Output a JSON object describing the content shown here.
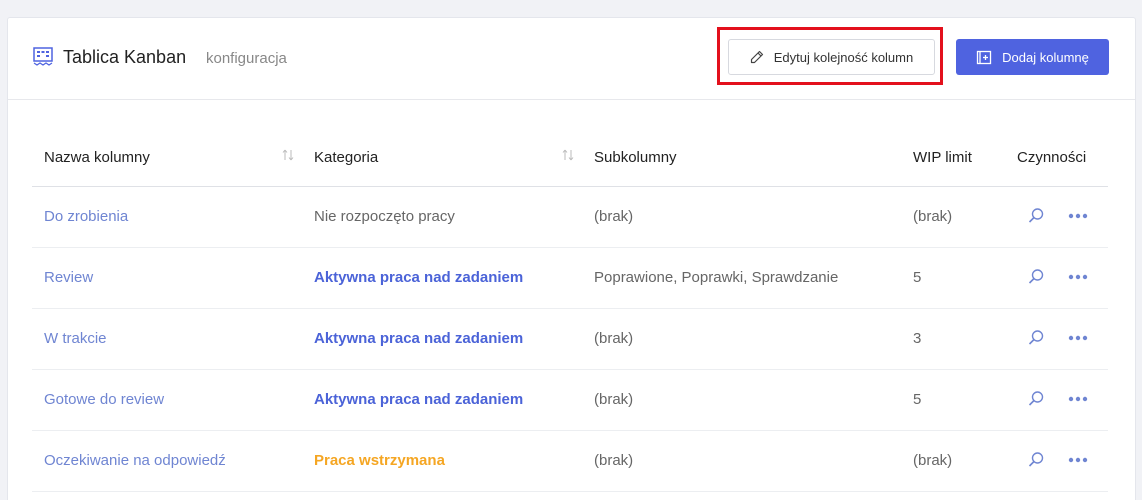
{
  "header": {
    "title": "Tablica Kanban",
    "subtitle": "konfiguracja",
    "edit_order_label": "Edytuj kolejność kolumn",
    "add_column_label": "Dodaj kolumnę"
  },
  "colors": {
    "accent": "#4f63e0",
    "link": "#6f85d2",
    "active_work": "#4b63d8",
    "paused": "#f5a623",
    "highlight": "#e3101c"
  },
  "table": {
    "headers": {
      "name": "Nazwa kolumny",
      "category": "Kategoria",
      "subcolumns": "Subkolumny",
      "wip": "WIP limit",
      "actions": "Czynności"
    },
    "rows": [
      {
        "name": "Do zrobienia",
        "category": "Nie rozpoczęto pracy",
        "category_kind": "not_started",
        "subcolumns": "(brak)",
        "wip": "(brak)"
      },
      {
        "name": "Review",
        "category": "Aktywna praca nad zadaniem",
        "category_kind": "active",
        "subcolumns": "Poprawione, Poprawki, Sprawdzanie",
        "wip": "5"
      },
      {
        "name": "W trakcie",
        "category": "Aktywna praca nad zadaniem",
        "category_kind": "active",
        "subcolumns": "(brak)",
        "wip": "3"
      },
      {
        "name": "Gotowe do review",
        "category": "Aktywna praca nad zadaniem",
        "category_kind": "active",
        "subcolumns": "(brak)",
        "wip": "5"
      },
      {
        "name": "Oczekiwanie na odpowiedź",
        "category": "Praca wstrzymana",
        "category_kind": "paused",
        "subcolumns": "(brak)",
        "wip": "(brak)"
      }
    ]
  }
}
